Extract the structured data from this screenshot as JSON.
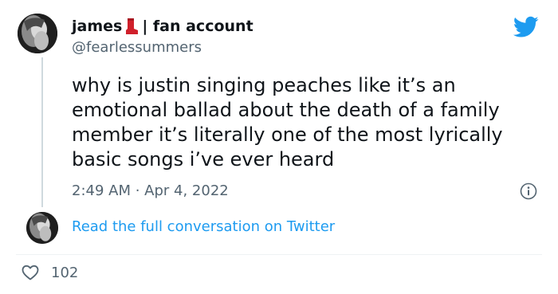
{
  "tweet": {
    "display_name": "james",
    "name_suffix": "| fan account",
    "handle": "@fearlessummers",
    "text_lines": [
      "why is justin singing peaches like it’s an",
      "emotional ballad about the death of a family",
      "member it’s literally one of the most lyrically",
      "basic songs i’ve ever heard"
    ],
    "timestamp": "2:49 AM · Apr 4, 2022",
    "read_more_label": "Read the full conversation on Twitter",
    "like_count": "102"
  },
  "icons": {
    "name_emoji": "red-boot-icon",
    "brand": "twitter-bird-icon",
    "info": "info-icon",
    "like": "heart-icon"
  },
  "colors": {
    "brand_blue": "#1d9bf0",
    "text_primary": "#0f1419",
    "text_secondary": "#536471",
    "thread_line": "#cfd9de",
    "boot_red": "#d0202b"
  }
}
